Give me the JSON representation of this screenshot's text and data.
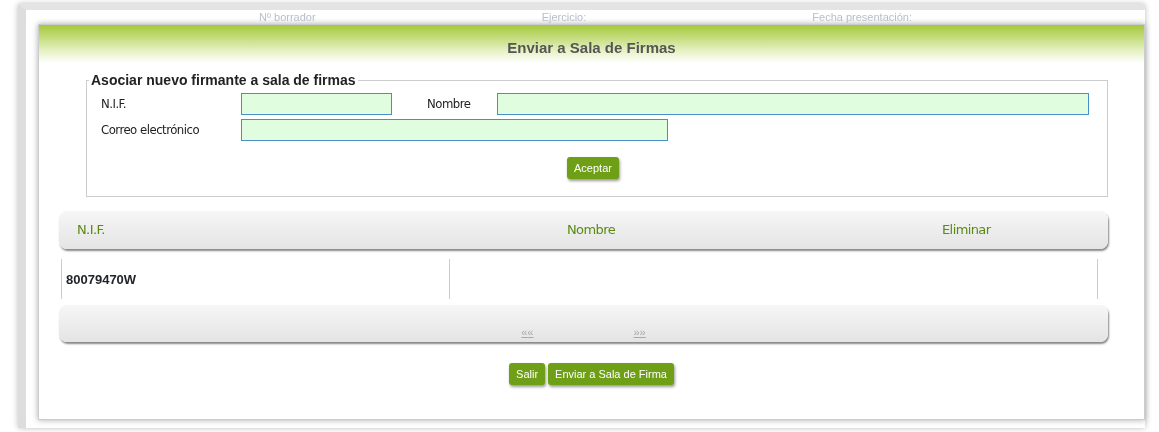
{
  "background_labels": [
    "Nº borrador",
    "Ejercicio:",
    "Fecha presentación:"
  ],
  "dialog": {
    "title": "Enviar a Sala de Firmas"
  },
  "form": {
    "legend": "Asociar nuevo firmante a sala de firmas",
    "fields": [
      {
        "label": "N.I.F."
      },
      {
        "label": "Nombre"
      },
      {
        "label": "Correo electrónico"
      }
    ],
    "submit": "Aceptar"
  },
  "table": {
    "columns": [
      "N.I.F.",
      "Nombre",
      "Eliminar"
    ],
    "rows": [
      [
        "80079470W",
        ""
      ]
    ]
  },
  "pager": {
    "first": "««",
    "last": "»»",
    "disabled": true
  },
  "buttons": [
    "Salir",
    "Enviar a Sala de Firma"
  ]
}
